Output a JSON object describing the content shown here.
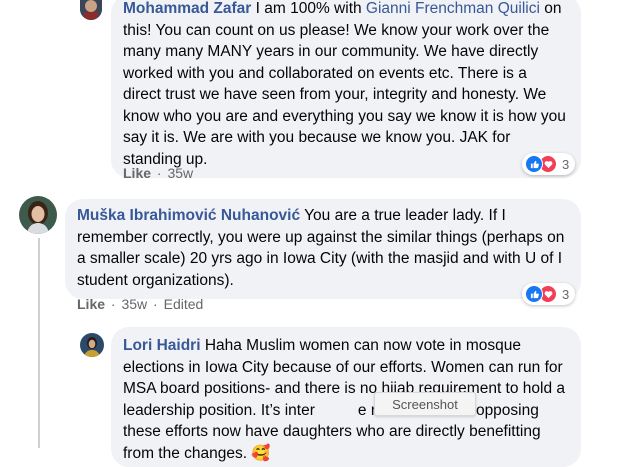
{
  "comments": [
    {
      "author": "Mohammad Zafar",
      "mention": "Gianni Frenchman Quilici",
      "text_before": " I am 100% with ",
      "text_after": " on this! You can count on us please! We know your work over the many many MANY years in our community. We have directly worked with you and collaborated on events etc. There is a direct trust we have seen from your, integrity and honesty. We know who you are and everything you say we know it is how you say it is. We are with you because we know you. JAK for standing up.",
      "like_label": "Like",
      "time": "35w",
      "reaction_count": "3"
    },
    {
      "author": "Muška Ibrahimović Nuhanović",
      "text": " You are a true leader lady. If I remember correctly, you were up against the similar things (perhaps on a smaller scale) 20 yrs ago in Iowa City (with the masjid and with U of I student organizations).",
      "like_label": "Like",
      "time": "35w",
      "edited": "Edited",
      "reaction_count": "3"
    },
    {
      "author": "Lori Haidri",
      "text": " Haha Muslim women can now vote in mosque elections in Iowa City because of our efforts. Women can run for MSA board positions- and there is no hijab requirement to hold a leadership position. It’s inter          e men who were opposing these efforts now have daughters who are directly benefitting from the changes. 🥰"
    }
  ],
  "tooltip": "Screenshot",
  "separator": "·",
  "icons": [
    "like-reaction-icon",
    "love-reaction-icon"
  ],
  "colors": {
    "link": "#385898",
    "like": "#1877f2",
    "love": "#f33e58",
    "bubble": "#f0f2f5"
  }
}
